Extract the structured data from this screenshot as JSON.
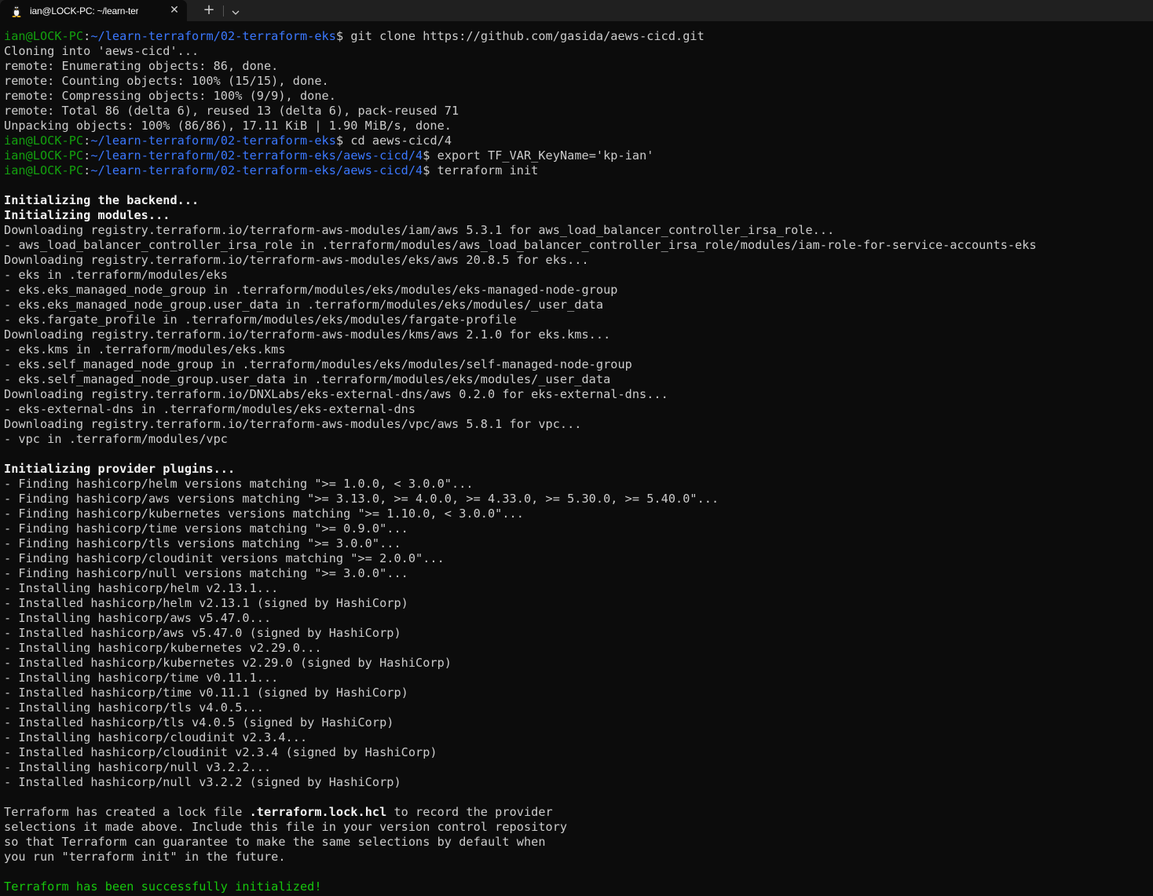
{
  "tab": {
    "title": "ian@LOCK-PC: ~/learn-terraform",
    "icon": "linux-penguin-icon",
    "close_glyph": "✕",
    "new_tab_glyph": "+",
    "dropdown_icon": "chevron-down-icon"
  },
  "colors": {
    "background": "#0c0c0c",
    "text": "#cccccc",
    "prompt_user": "#13a10e",
    "prompt_path": "#3b78ff",
    "success": "#16c60c"
  },
  "lines": [
    {
      "type": "prompt",
      "user": "ian@LOCK-PC",
      "path": "~/learn-terraform/02-terraform-eks",
      "cmd": "git clone https://github.com/gasida/aews-cicd.git"
    },
    {
      "type": "text",
      "text": "Cloning into 'aews-cicd'..."
    },
    {
      "type": "text",
      "text": "remote: Enumerating objects: 86, done."
    },
    {
      "type": "text",
      "text": "remote: Counting objects: 100% (15/15), done."
    },
    {
      "type": "text",
      "text": "remote: Compressing objects: 100% (9/9), done."
    },
    {
      "type": "text",
      "text": "remote: Total 86 (delta 6), reused 13 (delta 6), pack-reused 71"
    },
    {
      "type": "text",
      "text": "Unpacking objects: 100% (86/86), 17.11 KiB | 1.90 MiB/s, done."
    },
    {
      "type": "prompt",
      "user": "ian@LOCK-PC",
      "path": "~/learn-terraform/02-terraform-eks",
      "cmd": "cd aews-cicd/4"
    },
    {
      "type": "prompt",
      "user": "ian@LOCK-PC",
      "path": "~/learn-terraform/02-terraform-eks/aews-cicd/4",
      "cmd": "export TF_VAR_KeyName='kp-ian'"
    },
    {
      "type": "prompt",
      "user": "ian@LOCK-PC",
      "path": "~/learn-terraform/02-terraform-eks/aews-cicd/4",
      "cmd": "terraform init"
    },
    {
      "type": "text",
      "text": ""
    },
    {
      "type": "bold",
      "text": "Initializing the backend..."
    },
    {
      "type": "bold",
      "text": "Initializing modules..."
    },
    {
      "type": "text",
      "text": "Downloading registry.terraform.io/terraform-aws-modules/iam/aws 5.3.1 for aws_load_balancer_controller_irsa_role..."
    },
    {
      "type": "text",
      "text": "- aws_load_balancer_controller_irsa_role in .terraform/modules/aws_load_balancer_controller_irsa_role/modules/iam-role-for-service-accounts-eks"
    },
    {
      "type": "text",
      "text": "Downloading registry.terraform.io/terraform-aws-modules/eks/aws 20.8.5 for eks..."
    },
    {
      "type": "text",
      "text": "- eks in .terraform/modules/eks"
    },
    {
      "type": "text",
      "text": "- eks.eks_managed_node_group in .terraform/modules/eks/modules/eks-managed-node-group"
    },
    {
      "type": "text",
      "text": "- eks.eks_managed_node_group.user_data in .terraform/modules/eks/modules/_user_data"
    },
    {
      "type": "text",
      "text": "- eks.fargate_profile in .terraform/modules/eks/modules/fargate-profile"
    },
    {
      "type": "text",
      "text": "Downloading registry.terraform.io/terraform-aws-modules/kms/aws 2.1.0 for eks.kms..."
    },
    {
      "type": "text",
      "text": "- eks.kms in .terraform/modules/eks.kms"
    },
    {
      "type": "text",
      "text": "- eks.self_managed_node_group in .terraform/modules/eks/modules/self-managed-node-group"
    },
    {
      "type": "text",
      "text": "- eks.self_managed_node_group.user_data in .terraform/modules/eks/modules/_user_data"
    },
    {
      "type": "text",
      "text": "Downloading registry.terraform.io/DNXLabs/eks-external-dns/aws 0.2.0 for eks-external-dns..."
    },
    {
      "type": "text",
      "text": "- eks-external-dns in .terraform/modules/eks-external-dns"
    },
    {
      "type": "text",
      "text": "Downloading registry.terraform.io/terraform-aws-modules/vpc/aws 5.8.1 for vpc..."
    },
    {
      "type": "text",
      "text": "- vpc in .terraform/modules/vpc"
    },
    {
      "type": "text",
      "text": ""
    },
    {
      "type": "bold",
      "text": "Initializing provider plugins..."
    },
    {
      "type": "text",
      "text": "- Finding hashicorp/helm versions matching \">= 1.0.0, < 3.0.0\"..."
    },
    {
      "type": "text",
      "text": "- Finding hashicorp/aws versions matching \">= 3.13.0, >= 4.0.0, >= 4.33.0, >= 5.30.0, >= 5.40.0\"..."
    },
    {
      "type": "text",
      "text": "- Finding hashicorp/kubernetes versions matching \">= 1.10.0, < 3.0.0\"..."
    },
    {
      "type": "text",
      "text": "- Finding hashicorp/time versions matching \">= 0.9.0\"..."
    },
    {
      "type": "text",
      "text": "- Finding hashicorp/tls versions matching \">= 3.0.0\"..."
    },
    {
      "type": "text",
      "text": "- Finding hashicorp/cloudinit versions matching \">= 2.0.0\"..."
    },
    {
      "type": "text",
      "text": "- Finding hashicorp/null versions matching \">= 3.0.0\"..."
    },
    {
      "type": "text",
      "text": "- Installing hashicorp/helm v2.13.1..."
    },
    {
      "type": "text",
      "text": "- Installed hashicorp/helm v2.13.1 (signed by HashiCorp)"
    },
    {
      "type": "text",
      "text": "- Installing hashicorp/aws v5.47.0..."
    },
    {
      "type": "text",
      "text": "- Installed hashicorp/aws v5.47.0 (signed by HashiCorp)"
    },
    {
      "type": "text",
      "text": "- Installing hashicorp/kubernetes v2.29.0..."
    },
    {
      "type": "text",
      "text": "- Installed hashicorp/kubernetes v2.29.0 (signed by HashiCorp)"
    },
    {
      "type": "text",
      "text": "- Installing hashicorp/time v0.11.1..."
    },
    {
      "type": "text",
      "text": "- Installed hashicorp/time v0.11.1 (signed by HashiCorp)"
    },
    {
      "type": "text",
      "text": "- Installing hashicorp/tls v4.0.5..."
    },
    {
      "type": "text",
      "text": "- Installed hashicorp/tls v4.0.5 (signed by HashiCorp)"
    },
    {
      "type": "text",
      "text": "- Installing hashicorp/cloudinit v2.3.4..."
    },
    {
      "type": "text",
      "text": "- Installed hashicorp/cloudinit v2.3.4 (signed by HashiCorp)"
    },
    {
      "type": "text",
      "text": "- Installing hashicorp/null v3.2.2..."
    },
    {
      "type": "text",
      "text": "- Installed hashicorp/null v3.2.2 (signed by HashiCorp)"
    },
    {
      "type": "text",
      "text": ""
    },
    {
      "type": "mixed",
      "before": "Terraform has created a lock file ",
      "bold": ".terraform.lock.hcl",
      "after": " to record the provider"
    },
    {
      "type": "text",
      "text": "selections it made above. Include this file in your version control repository"
    },
    {
      "type": "text",
      "text": "so that Terraform can guarantee to make the same selections by default when"
    },
    {
      "type": "text",
      "text": "you run \"terraform init\" in the future."
    },
    {
      "type": "text",
      "text": ""
    },
    {
      "type": "success",
      "text": "Terraform has been successfully initialized!"
    }
  ]
}
